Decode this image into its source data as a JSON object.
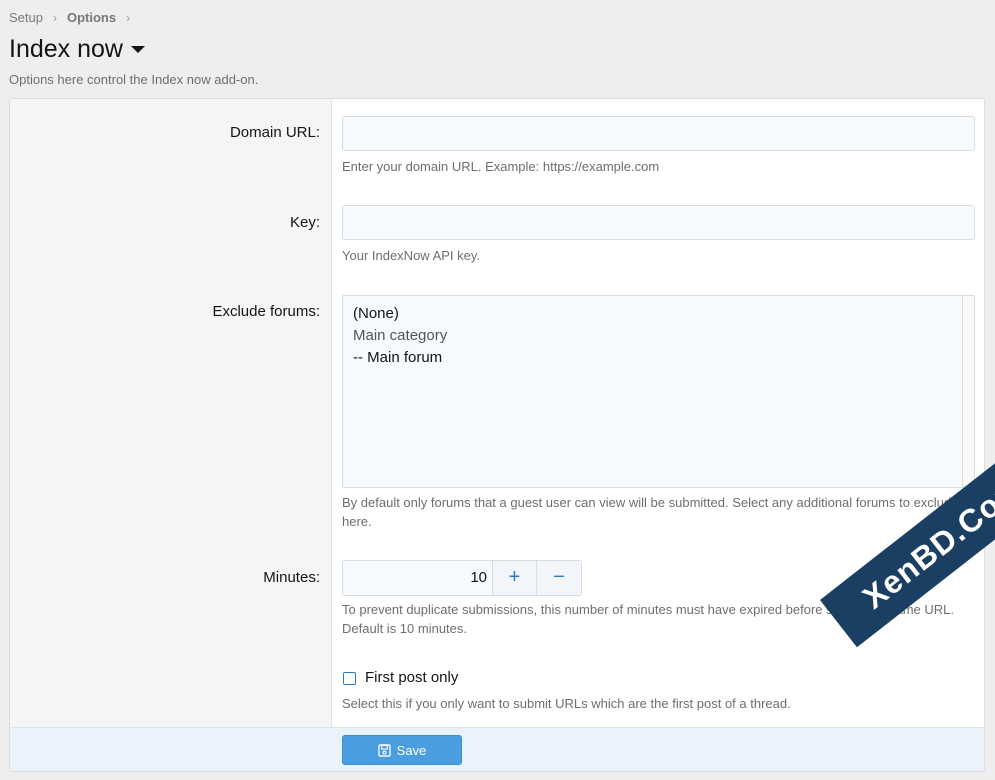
{
  "breadcrumb": {
    "items": [
      "Setup",
      "Options"
    ],
    "separator": "›"
  },
  "page": {
    "title": "Index now",
    "description": "Options here control the Index now add-on."
  },
  "form": {
    "domain_url": {
      "label": "Domain URL:",
      "value": "",
      "hint": "Enter your domain URL. Example: https://example.com"
    },
    "key": {
      "label": "Key:",
      "value": "",
      "hint": "Your IndexNow API key."
    },
    "exclude_forums": {
      "label": "Exclude forums:",
      "options": [
        "(None)",
        "Main category",
        "-- Main forum"
      ],
      "hint": "By default only forums that a guest user can view will be submitted. Select any additional forums to exclude here."
    },
    "minutes": {
      "label": "Minutes:",
      "value": "10",
      "plus": "+",
      "minus": "−",
      "hint": "To prevent duplicate submissions, this number of minutes must have expired before submitting same URL. Default is 10 minutes."
    },
    "first_post_only": {
      "label": "First post only",
      "checked": false,
      "hint": "Select this if you only want to submit URLs which are the first post of a thread."
    },
    "save_label": "Save"
  },
  "watermark": "XenBD.Com",
  "colors": {
    "accent": "#2b7ac4",
    "button": "#4a9ee0",
    "footer": "#eaf3fb"
  }
}
